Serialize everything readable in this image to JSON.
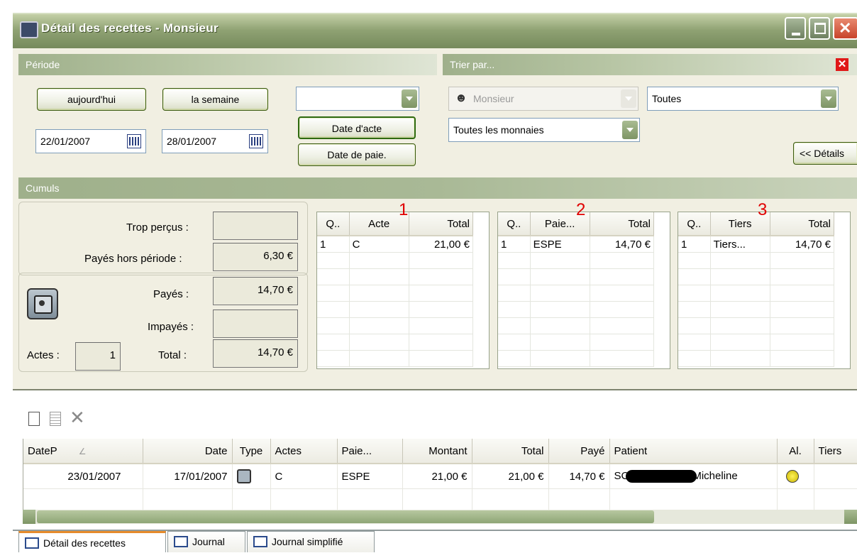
{
  "window": {
    "title": "Détail des recettes - Monsieur"
  },
  "periode": {
    "header": "Période",
    "today_label": "aujourd'hui",
    "week_label": "la semaine",
    "date_from": "22/01/2007",
    "date_to": "28/01/2007",
    "range_select_value": "",
    "date_acte_label": "Date d'acte",
    "date_paie_label": "Date de paie."
  },
  "trier": {
    "header": "Trier par...",
    "practitioner_value": "Monsieur",
    "filter_value": "Toutes",
    "currency_value": "Toutes les monnaies",
    "details_label": "<< Détails"
  },
  "cumuls": {
    "header": "Cumuls",
    "trop_percus_label": "Trop perçus :",
    "trop_percus_value": "",
    "payes_hors_label": "Payés hors période :",
    "payes_hors_value": "6,30 €",
    "payes_label": "Payés :",
    "payes_value": "14,70 €",
    "impayes_label": "Impayés :",
    "impayes_value": "",
    "actes_label": "Actes :",
    "actes_value": "1",
    "total_label": "Total :",
    "total_value": "14,70 €"
  },
  "grids": [
    {
      "marker": "1",
      "headers": [
        "Q..",
        "Acte",
        "Total"
      ],
      "rows": [
        [
          "1",
          "C",
          "21,00 €"
        ]
      ]
    },
    {
      "marker": "2",
      "headers": [
        "Q..",
        "Paie...",
        "Total"
      ],
      "rows": [
        [
          "1",
          "ESPE",
          "14,70 €"
        ]
      ]
    },
    {
      "marker": "3",
      "headers": [
        "Q..",
        "Tiers",
        "Total"
      ],
      "rows": [
        [
          "1",
          "Tiers...",
          "14,70 €"
        ]
      ]
    }
  ],
  "list": {
    "headers": [
      "DateP",
      "Date",
      "Type",
      "Actes",
      "Paie...",
      "Montant",
      "Total",
      "Payé",
      "Patient",
      "Al.",
      "Tiers"
    ],
    "rows": [
      {
        "datep": "23/01/2007",
        "date": "17/01/2007",
        "actes": "C",
        "paie": "ESPE",
        "montant": "21,00 €",
        "total": "21,00 €",
        "paye": "14,70 €",
        "patient_prefix": "SC",
        "patient_suffix": "Micheline"
      }
    ]
  },
  "tabs": [
    "Détail des recettes",
    "Journal",
    "Journal simplifié"
  ],
  "colors": {
    "accent": "#8fa273",
    "header_green": "#9fb08b",
    "marker_red": "#e00000"
  }
}
